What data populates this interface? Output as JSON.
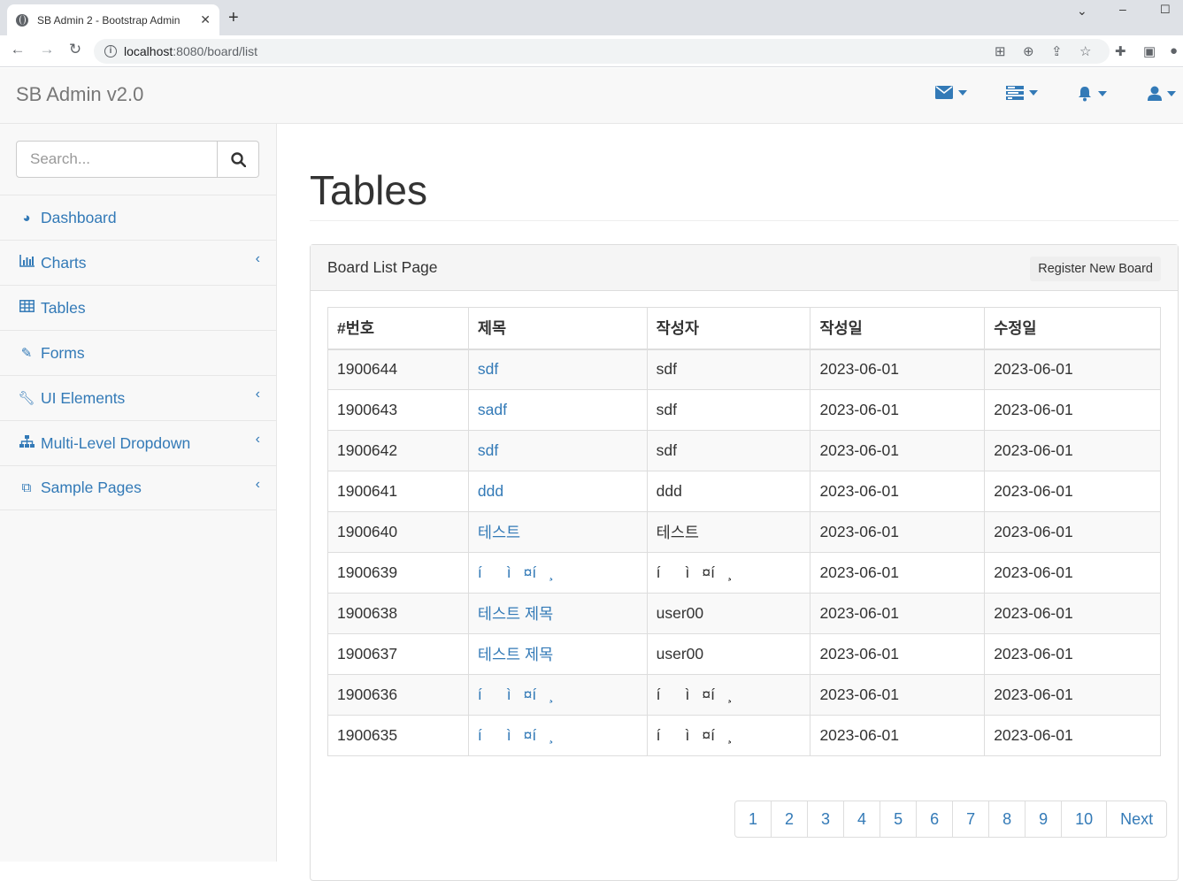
{
  "browser": {
    "tab_title": "SB Admin 2 - Bootstrap Admin",
    "url_host": "localhost",
    "url_path": ":8080/board/list"
  },
  "navbar": {
    "brand": "SB Admin v2.0",
    "icons": [
      "envelope-icon",
      "tasks-icon",
      "bell-icon",
      "user-icon"
    ]
  },
  "sidebar": {
    "search_placeholder": "Search...",
    "items": [
      {
        "label": "Dashboard",
        "icon": "dashboard-icon",
        "has_arrow": false
      },
      {
        "label": "Charts",
        "icon": "bar-chart-icon",
        "has_arrow": true
      },
      {
        "label": "Tables",
        "icon": "table-icon",
        "has_arrow": false
      },
      {
        "label": "Forms",
        "icon": "edit-icon",
        "has_arrow": false
      },
      {
        "label": "UI Elements",
        "icon": "wrench-icon",
        "has_arrow": true
      },
      {
        "label": "Multi-Level Dropdown",
        "icon": "sitemap-icon",
        "has_arrow": true
      },
      {
        "label": "Sample Pages",
        "icon": "files-icon",
        "has_arrow": true
      }
    ]
  },
  "page": {
    "title": "Tables",
    "panel_title": "Board List Page",
    "register_button": "Register New Board"
  },
  "table": {
    "headers": [
      "#번호",
      "제목",
      "작성자",
      "작성일",
      "수정일"
    ],
    "rows": [
      [
        "1900644",
        "sdf",
        "sdf",
        "2023-06-01",
        "2023-06-01"
      ],
      [
        "1900643",
        "sadf",
        "sdf",
        "2023-06-01",
        "2023-06-01"
      ],
      [
        "1900642",
        "sdf",
        "sdf",
        "2023-06-01",
        "2023-06-01"
      ],
      [
        "1900641",
        "ddd",
        "ddd",
        "2023-06-01",
        "2023-06-01"
      ],
      [
        "1900640",
        "테스트",
        "테스트",
        "2023-06-01",
        "2023-06-01"
      ],
      [
        "1900639",
        "íì¤í¸",
        "íì¤í¸",
        "2023-06-01",
        "2023-06-01"
      ],
      [
        "1900638",
        "테스트 제목",
        "user00",
        "2023-06-01",
        "2023-06-01"
      ],
      [
        "1900637",
        "테스트 제목",
        "user00",
        "2023-06-01",
        "2023-06-01"
      ],
      [
        "1900636",
        "íì¤í¸",
        "íì¤í¸",
        "2023-06-01",
        "2023-06-01"
      ],
      [
        "1900635",
        "íì¤í¸",
        "íì¤í¸",
        "2023-06-01",
        "2023-06-01"
      ]
    ]
  },
  "pagination": {
    "pages": [
      "1",
      "2",
      "3",
      "4",
      "5",
      "6",
      "7",
      "8",
      "9",
      "10"
    ],
    "next_label": "Next"
  },
  "colors": {
    "link": "#337ab7",
    "navbar_bg": "#f8f8f8",
    "border": "#dddddd"
  }
}
